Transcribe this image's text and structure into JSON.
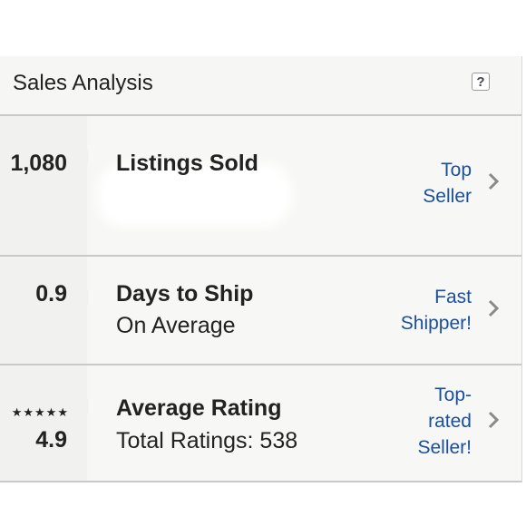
{
  "header": {
    "title": "Sales Analysis",
    "help_label": "?"
  },
  "rows": [
    {
      "stat": "1,080",
      "title": "Listings Sold",
      "subtitle": "",
      "badge_lines": [
        "Top",
        "Seller"
      ]
    },
    {
      "stat": "0.9",
      "title": "Days to Ship",
      "subtitle": "On Average",
      "badge_lines": [
        "Fast",
        "Shipper!"
      ]
    },
    {
      "stat": "4.9",
      "stars": "★★★★★",
      "title": "Average Rating",
      "subtitle": "Total Ratings: 538",
      "badge_lines": [
        "Top-",
        "rated",
        "Seller!"
      ]
    }
  ],
  "colors": {
    "badge_link": "#1a4f9c",
    "text": "#222222",
    "panel_bg": "#f7f7f5",
    "chevron": "#8a8a8a"
  },
  "icons": {
    "chevron": "chevron-right-icon",
    "rating": "star-icon",
    "help": "question-mark-icon"
  }
}
